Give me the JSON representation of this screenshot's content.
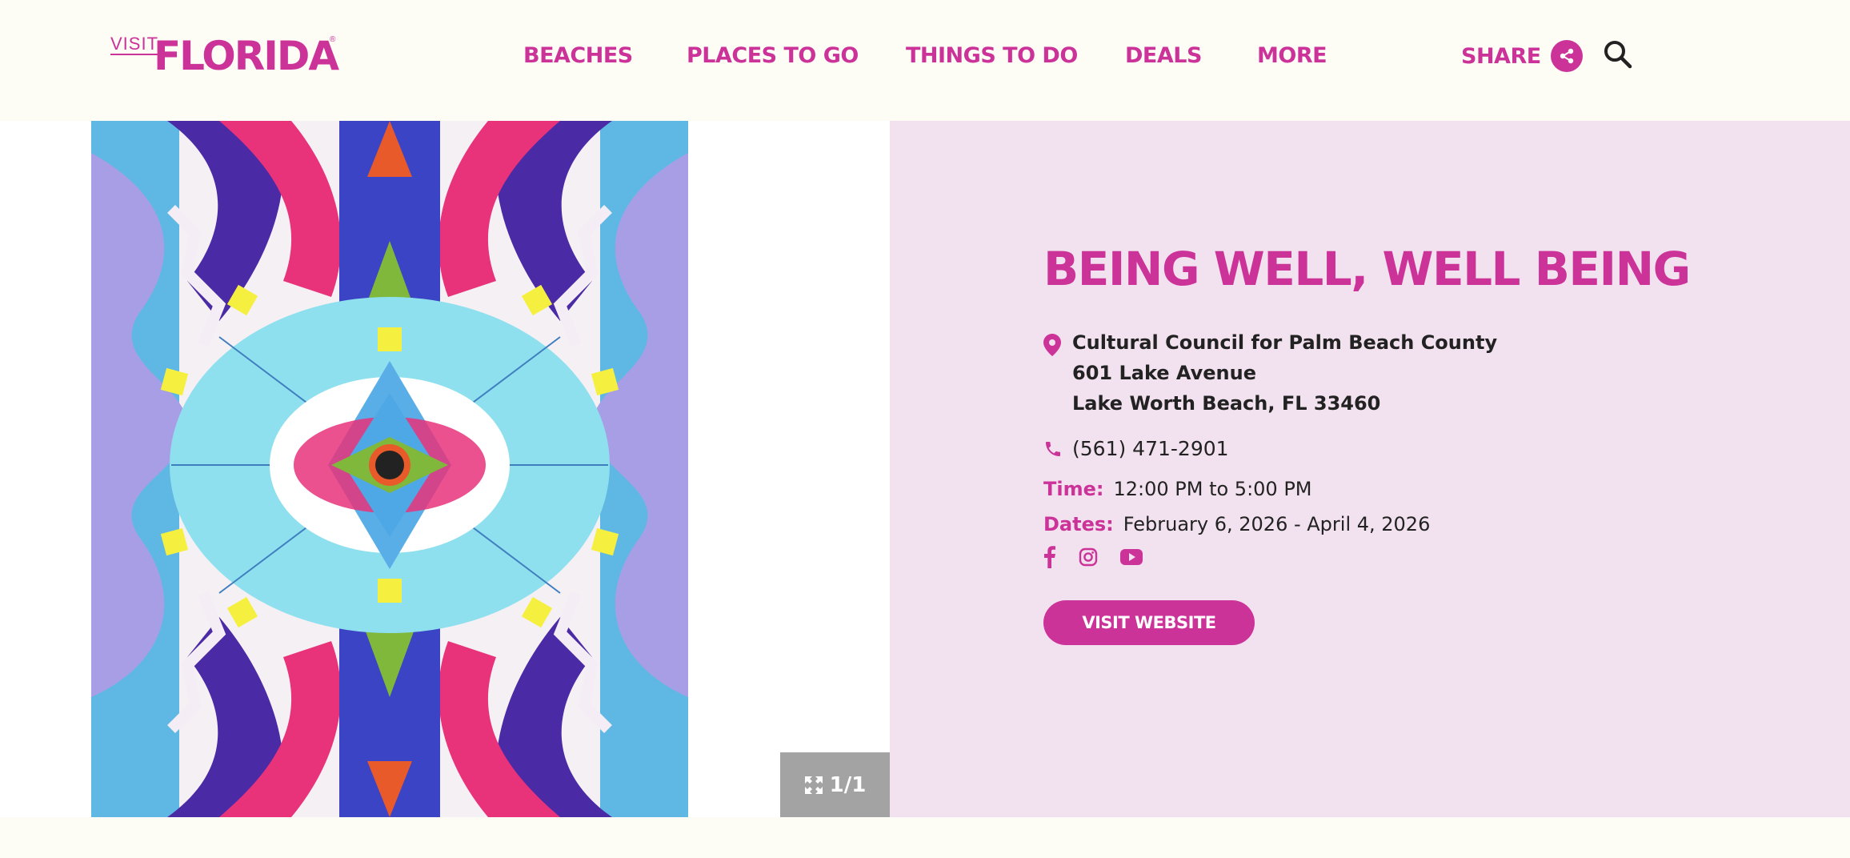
{
  "logo": {
    "visit": "VISIT",
    "florida": "FLORIDA",
    "reg": "®"
  },
  "nav": {
    "items": [
      {
        "label": "BEACHES"
      },
      {
        "label": "PLACES TO GO"
      },
      {
        "label": "THINGS TO DO"
      },
      {
        "label": "DEALS"
      },
      {
        "label": "MORE"
      }
    ],
    "share_label": "SHARE"
  },
  "gallery": {
    "counter": "1/1"
  },
  "event": {
    "title": "BEING WELL, WELL BEING",
    "address": {
      "line1": "Cultural Council for Palm Beach County",
      "line2": "601 Lake Avenue",
      "line3": "Lake Worth Beach, FL 33460"
    },
    "phone": "(561) 471-2901",
    "time_label": "Time:",
    "time_value": "12:00 PM to 5:00 PM",
    "dates_label": "Dates:",
    "dates_value": "February 6, 2026 - April 4, 2026",
    "socials": [
      "facebook-icon",
      "instagram-icon",
      "youtube-icon"
    ],
    "website_button": "VISIT WEBSITE"
  },
  "colors": {
    "brand_pink": "#cc3399",
    "panel_bg": "#f2e1ee",
    "page_bg": "#fdfdf6",
    "counter_bg": "#a3a3a3"
  }
}
